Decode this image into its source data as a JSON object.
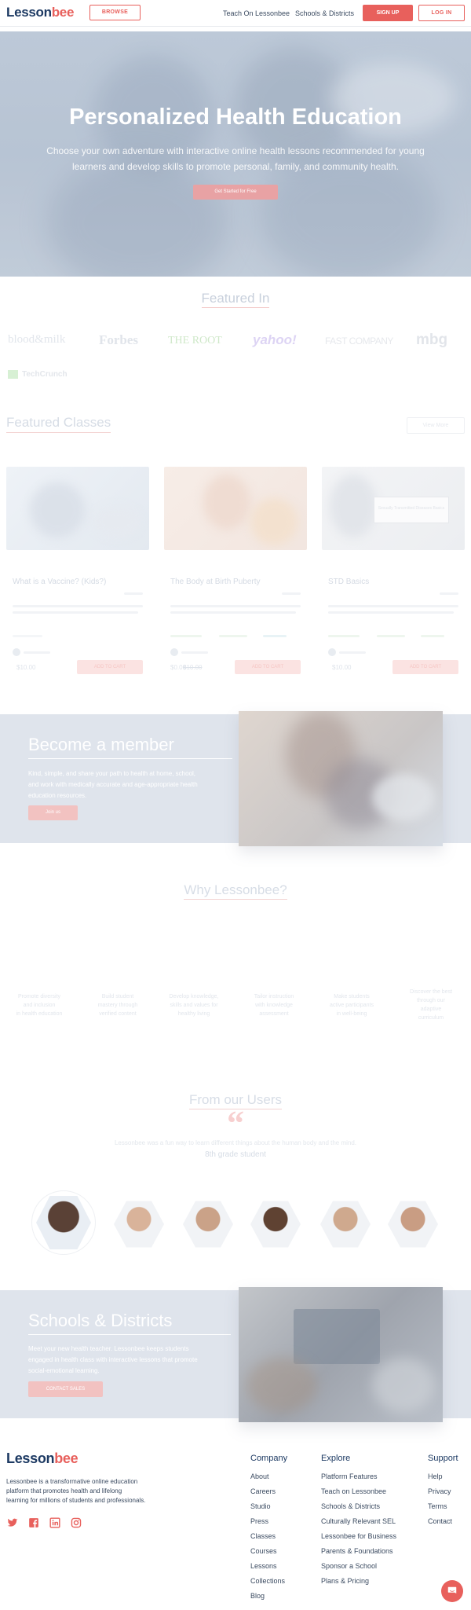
{
  "brand": {
    "logo_a": "Lesson",
    "logo_b": "bee",
    "accent": "#e8605c",
    "navy": "#1d3a63"
  },
  "header": {
    "browse_label": "BROWSE",
    "teach_label": "Teach On Lessonbee",
    "schools_label": "Schools & Districts",
    "signup_label": "SIGN UP",
    "login_label": "LOG IN"
  },
  "hero": {
    "title": "Personalized Health Education",
    "subtitle_1": "Choose your own adventure with interactive online health lessons recommended for young",
    "subtitle_2": "learners and develop skills to promote personal, family, and community health.",
    "cta_label": "Get Started for Free"
  },
  "featured_in": {
    "heading": "Featured In",
    "logos": [
      "blood&milk",
      "Forbes",
      "THE ROOT",
      "yahoo!",
      "FAST COMPANY",
      "mbg",
      "TechCrunch"
    ]
  },
  "featured_classes": {
    "heading": "Featured Classes",
    "view_more_label": "View More",
    "cards": [
      {
        "title": "What is a Vaccine? (Kids?)",
        "price": "$10.00",
        "button": "ADD TO CART"
      },
      {
        "title": "The Body at Birth Puberty",
        "price": "$0.00",
        "old_price": "$10.00",
        "button": "ADD TO CART"
      },
      {
        "title": "STD Basics",
        "price": "$10.00",
        "button": "ADD TO CART",
        "image_caption": "Sexually Transmitted Diseases Basics"
      }
    ]
  },
  "member": {
    "heading": "Become a member",
    "body_1": "Kind, simple, and share your path to health at home, school,",
    "body_2": "and work with medically accurate and age-appropriate health",
    "body_3": "education resources.",
    "cta_label": "Join us"
  },
  "why": {
    "heading": "Why Lessonbee?",
    "items": [
      [
        "Promote diversity",
        "and inclusion",
        "in health education"
      ],
      [
        "Build student",
        "mastery through",
        "verified content"
      ],
      [
        "Develop knowledge,",
        "skills and values for",
        "healthy living"
      ],
      [
        "Tailor instruction",
        "with knowledge",
        "assessment"
      ],
      [
        "Make students",
        "active participants",
        "in well-being"
      ],
      [
        "Discover the best",
        "through our",
        "adaptive",
        "curriculum"
      ]
    ]
  },
  "users": {
    "heading": "From our Users",
    "quote_icon": "quote-icon",
    "quote": "Lessonbee was a fun way to learn different things about the human body and the mind.",
    "author": "8th grade student"
  },
  "schools": {
    "heading": "Schools & Districts",
    "body_1": "Meet your new health teacher. Lessonbee keeps students",
    "body_2": "engaged in health class with interactive lessons that promote",
    "body_3": "social-emotional learning.",
    "cta_label": "CONTACT SALES"
  },
  "footer": {
    "about_1": "Lessonbee is a transformative online education",
    "about_2": "platform that promotes health and lifelong",
    "about_3": "learning for millions of students and professionals.",
    "company_heading": "Company",
    "company_links": [
      "About",
      "Careers",
      "Studio",
      "Press",
      "Classes",
      "Courses",
      "Lessons",
      "Collections",
      "Blog"
    ],
    "explore_heading": "Explore",
    "explore_links": [
      "Platform Features",
      "Teach on Lessonbee",
      "Schools & Districts",
      "Culturally Relevant SEL",
      "Lessonbee for Business",
      "Parents & Foundations",
      "Sponsor a School",
      "Plans & Pricing"
    ],
    "support_heading": "Support",
    "support_links": [
      "Help",
      "Privacy",
      "Terms",
      "Contact"
    ],
    "social_icons": [
      "twitter-icon",
      "facebook-icon",
      "linkedin-icon",
      "instagram-icon"
    ]
  },
  "chat_icon": "chat-icon"
}
